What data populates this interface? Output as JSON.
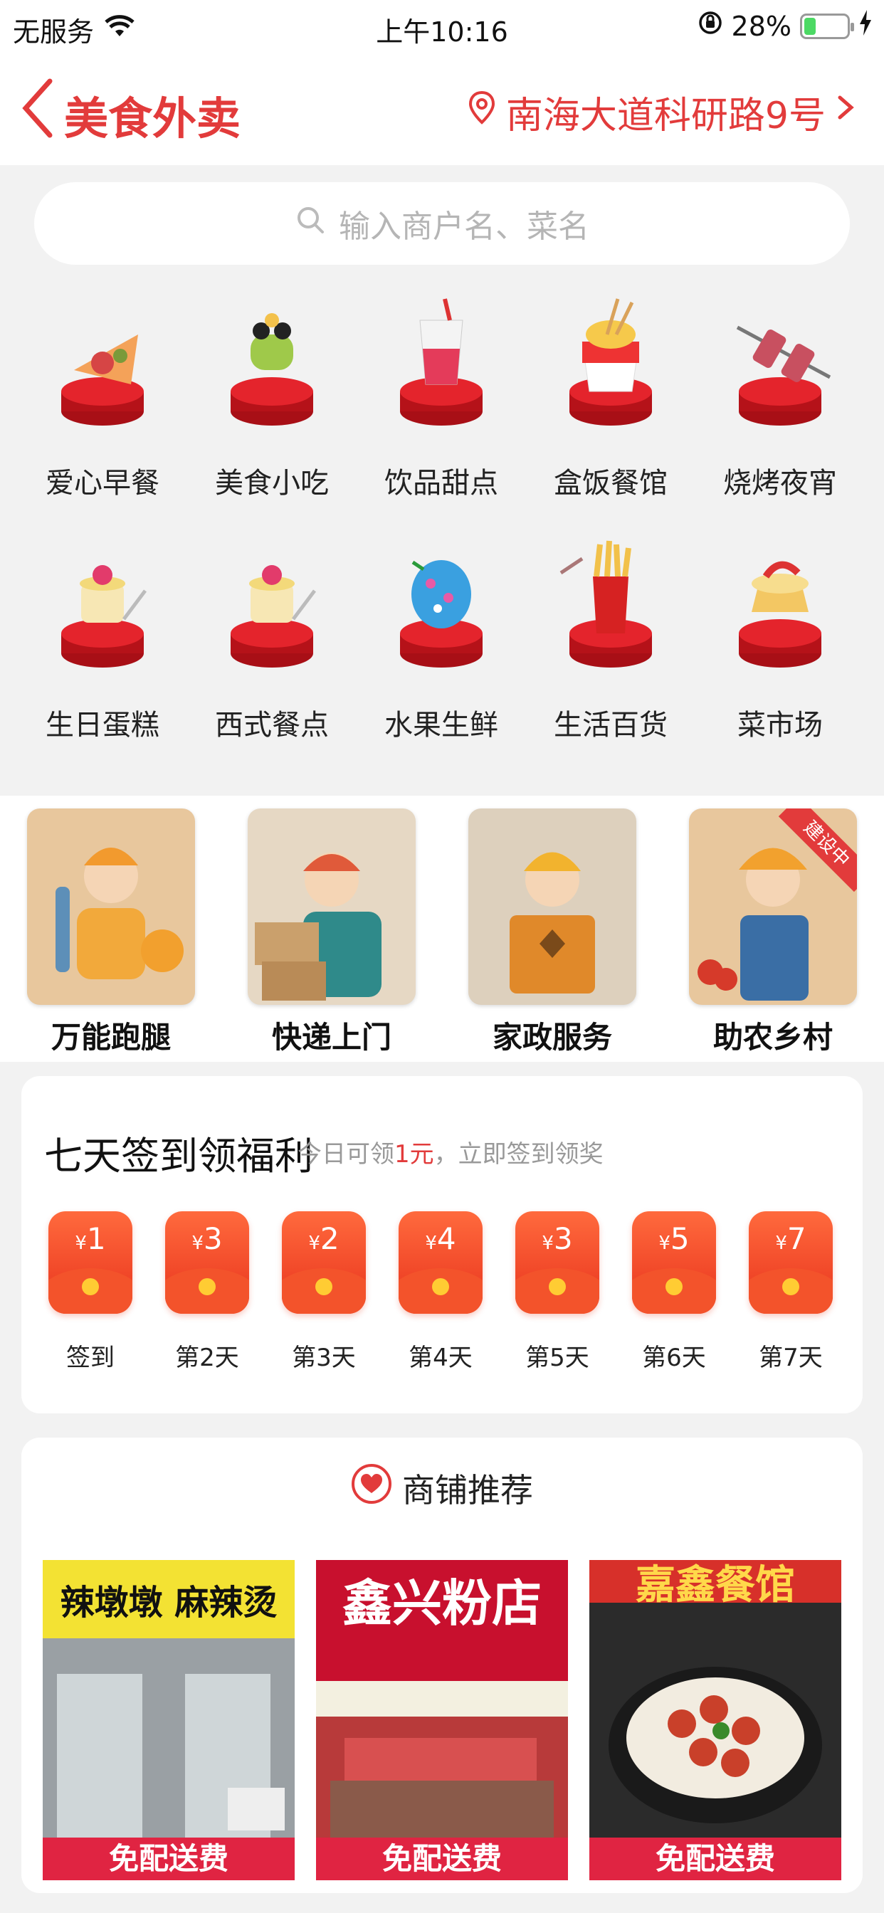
{
  "status_bar": {
    "carrier": "无服务",
    "time": "上午10:16",
    "battery_pct": "28%",
    "battery_level": 0.28
  },
  "nav": {
    "title": "美食外卖",
    "location": "南海大道科研路9号"
  },
  "search": {
    "placeholder": "输入商户名、菜名"
  },
  "categories": [
    {
      "label": "爱心早餐",
      "icon": "pizza-slice-icon"
    },
    {
      "label": "美食小吃",
      "icon": "skewer-snack-icon"
    },
    {
      "label": "饮品甜点",
      "icon": "drink-cup-icon"
    },
    {
      "label": "盒饭餐馆",
      "icon": "noodle-box-icon"
    },
    {
      "label": "烧烤夜宵",
      "icon": "bbq-skewer-icon"
    },
    {
      "label": "生日蛋糕",
      "icon": "cake-icon"
    },
    {
      "label": "西式餐点",
      "icon": "dessert-icon"
    },
    {
      "label": "水果生鲜",
      "icon": "fruit-icon"
    },
    {
      "label": "生活百货",
      "icon": "fries-icon"
    },
    {
      "label": "菜市场",
      "icon": "sandwich-icon"
    }
  ],
  "services": [
    {
      "label": "万能跑腿",
      "badge": ""
    },
    {
      "label": "快递上门",
      "badge": ""
    },
    {
      "label": "家政服务",
      "badge": ""
    },
    {
      "label": "助农乡村",
      "badge": "建设中"
    }
  ],
  "signin": {
    "title": "七天签到领福利",
    "sub_prefix": "今日可领",
    "sub_amount": "1元",
    "sub_suffix": "，立即签到领奖",
    "currency": "¥",
    "days": [
      {
        "amount": "1",
        "label": "签到"
      },
      {
        "amount": "3",
        "label": "第2天"
      },
      {
        "amount": "2",
        "label": "第3天"
      },
      {
        "amount": "4",
        "label": "第4天"
      },
      {
        "amount": "3",
        "label": "第5天"
      },
      {
        "amount": "5",
        "label": "第6天"
      },
      {
        "amount": "7",
        "label": "第7天"
      }
    ]
  },
  "recommend": {
    "title": "商铺推荐",
    "shops": [
      {
        "sign": "辣墩墩 麻辣烫",
        "tag": "免配送费"
      },
      {
        "sign": "鑫兴粉店",
        "tag": "免配送费"
      },
      {
        "sign": "嘉鑫餐馆",
        "tag": "免配送费"
      }
    ]
  },
  "colors": {
    "accent": "#e23b3b",
    "tag": "#e02442",
    "background": "#f2f2f2"
  }
}
